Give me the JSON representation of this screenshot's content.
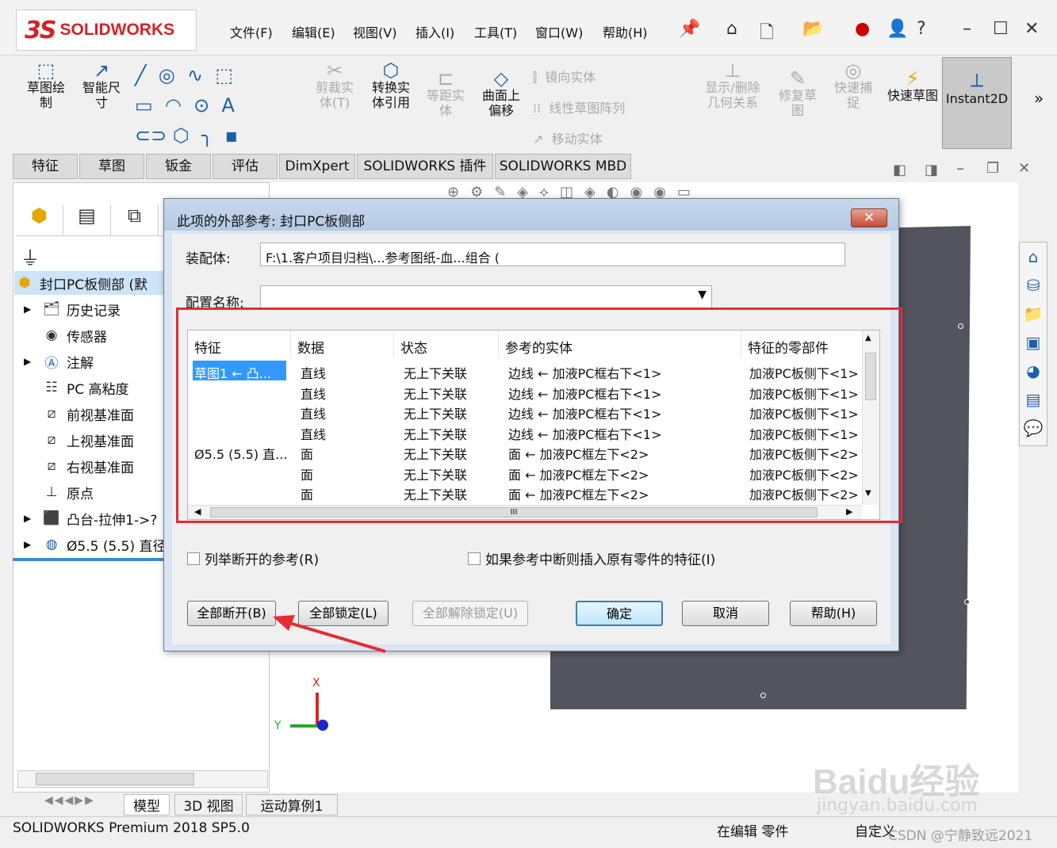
{
  "app": {
    "logo_text": "SOLIDWORKS",
    "menu": [
      "文件(F)",
      "编辑(E)",
      "视图(V)",
      "插入(I)",
      "工具(T)",
      "窗口(W)",
      "帮助(H)"
    ]
  },
  "ribbon": {
    "sketch_draw": "草图绘制",
    "smart_dim": "智能尺寸",
    "trim": "剪裁实体(T)",
    "convert": "转换实体引用",
    "offset": "等距实体",
    "surface_offset": "曲面上偏移",
    "mirror": "镜向实体",
    "linear_pattern": "线性草图阵列",
    "move": "移动实体",
    "show_relations": "显示/删除几何关系",
    "repair": "修复草图",
    "quick_snap": "快速捕捉",
    "quick_sketch": "快速草图",
    "instant2d": "Instant2D"
  },
  "command_tabs": [
    "特征",
    "草图",
    "钣金",
    "评估",
    "DimXpert",
    "SOLIDWORKS 插件",
    "SOLIDWORKS MBD"
  ],
  "tree": {
    "root": "封口PC板侧部 (默",
    "items": [
      "历史记录",
      "传感器",
      "注解",
      "PC 高粘度",
      "前视基准面",
      "上视基准面",
      "右视基准面",
      "原点",
      "凸台-拉伸1->?",
      "Ø5.5 (5.5) 直径"
    ]
  },
  "dialog": {
    "title": "此项的外部参考: 封口PC板侧部",
    "close": "✕",
    "assembly_label": "装配体:",
    "assembly_value": "F:\\1.客户项目归档\\...参考图纸-血...组合 (",
    "config_label": "配置名称:",
    "config_value": "",
    "columns": [
      "特征",
      "数据",
      "状态",
      "参考的实体",
      "特征的零部件"
    ],
    "rows": [
      {
        "feature": "草图1 ← 凸...",
        "data": "直线",
        "status": "无上下关联",
        "ref": "边线 ← 加液PC框右下<1>",
        "comp": "加液PC板侧下<1>"
      },
      {
        "feature": "",
        "data": "直线",
        "status": "无上下关联",
        "ref": "边线 ← 加液PC框右下<1>",
        "comp": "加液PC板侧下<1>"
      },
      {
        "feature": "",
        "data": "直线",
        "status": "无上下关联",
        "ref": "边线 ← 加液PC框右下<1>",
        "comp": "加液PC板侧下<1>"
      },
      {
        "feature": "",
        "data": "直线",
        "status": "无上下关联",
        "ref": "边线 ← 加液PC框右下<1>",
        "comp": "加液PC板侧下<1>"
      },
      {
        "feature": "Ø5.5 (5.5) 直...",
        "data": "面",
        "status": "无上下关联",
        "ref": "面 ← 加液PC框左下<2>",
        "comp": "加液PC板侧下<2>"
      },
      {
        "feature": "",
        "data": "面",
        "status": "无上下关联",
        "ref": "面 ← 加液PC框左下<2>",
        "comp": "加液PC板侧下<2>"
      },
      {
        "feature": "",
        "data": "面",
        "status": "无上下关联",
        "ref": "面 ← 加液PC框左下<2>",
        "comp": "加液PC板侧下<2>"
      }
    ],
    "hscroll_glyph": "III",
    "list_broken": "列举断开的参考(R)",
    "insert_original": "如果参考中断则插入原有零件的特征(I)",
    "btn_break_all": "全部断开(B)",
    "btn_lock_all": "全部锁定(L)",
    "btn_unlock_all": "全部解除锁定(U)",
    "btn_ok": "确定",
    "btn_cancel": "取消",
    "btn_help": "帮助(H)"
  },
  "triad": {
    "x": "X",
    "y": "Y"
  },
  "bottom_tabs": [
    "模型",
    "3D 视图",
    "运动算例1"
  ],
  "status": {
    "version": "SOLIDWORKS Premium 2018 SP5.0",
    "editing": "在编辑 零件",
    "custom": "自定义"
  },
  "watermark": {
    "baidu": "Baidu经验",
    "baidu_url": "jingyan.baidu.com",
    "csdn": "CSDN @宁静致远2021"
  },
  "colors": {
    "red_highlight": "#e52b35",
    "part_gray": "#54545f",
    "selection": "#3399ff"
  }
}
